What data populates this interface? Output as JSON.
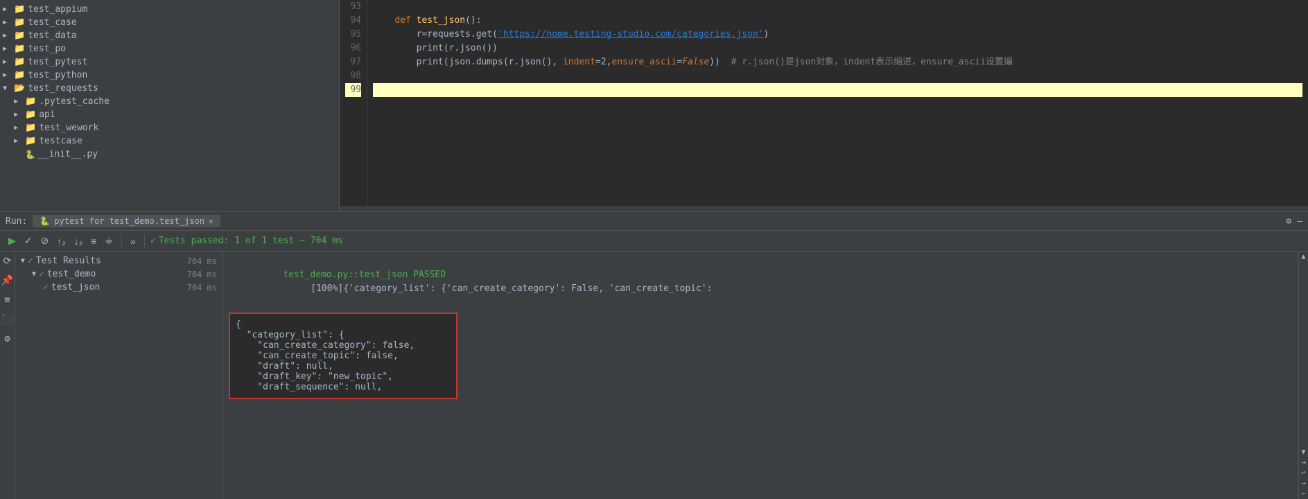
{
  "sidebar": {
    "items": [
      {
        "label": "test_appium",
        "type": "folder",
        "indent": 0,
        "expanded": false
      },
      {
        "label": "test_case",
        "type": "folder",
        "indent": 0,
        "expanded": false
      },
      {
        "label": "test_data",
        "type": "folder",
        "indent": 0,
        "expanded": false
      },
      {
        "label": "test_po",
        "type": "folder",
        "indent": 0,
        "expanded": false
      },
      {
        "label": "test_pytest",
        "type": "folder",
        "indent": 0,
        "expanded": false
      },
      {
        "label": "test_python",
        "type": "folder",
        "indent": 0,
        "expanded": false
      },
      {
        "label": "test_requests",
        "type": "folder",
        "indent": 0,
        "expanded": true
      },
      {
        "label": ".pytest_cache",
        "type": "folder",
        "indent": 1,
        "expanded": false
      },
      {
        "label": "api",
        "type": "folder",
        "indent": 1,
        "expanded": false
      },
      {
        "label": "test_wework",
        "type": "folder",
        "indent": 1,
        "expanded": false
      },
      {
        "label": "testcase",
        "type": "folder",
        "indent": 1,
        "expanded": false
      },
      {
        "label": "__init__.py",
        "type": "file_py",
        "indent": 1,
        "expanded": false
      }
    ]
  },
  "code": {
    "lines": [
      {
        "num": 93,
        "text": ""
      },
      {
        "num": 94,
        "text": "    def test_json():"
      },
      {
        "num": 95,
        "text": "        r=requests.get('https://home.testing-studio.com/categories.json')"
      },
      {
        "num": 96,
        "text": "        print(r.json())"
      },
      {
        "num": 97,
        "text": "        print(json.dumps(r.json(), indent=2,ensure_ascii=False))  # r.json()是json对象，indent表示缩进，ensure_ascii设置编"
      },
      {
        "num": 98,
        "text": ""
      },
      {
        "num": 99,
        "text": "",
        "highlighted": true
      }
    ],
    "url": "https://home.testing-studio.com/categories.json"
  },
  "run": {
    "header_label": "Run:",
    "tab_label": "pytest for test_demo.test_json",
    "gear_icon": "⚙",
    "dash_icon": "—",
    "toolbar": {
      "play_icon": "▶",
      "check_all_icon": "✓",
      "stop_icon": "⊘",
      "sort_asc_icon": "↑↓",
      "sort_desc_icon": "↓↑",
      "filter_icon": "≡",
      "filter2_icon": "≑",
      "more_icon": "»",
      "status_check": "✓",
      "status_text": "Tests passed: 1 of 1 test – 704 ms"
    },
    "results": {
      "root_label": "Test Results",
      "root_time": "704 ms",
      "child1_label": "test_demo",
      "child1_time": "704 ms",
      "child2_label": "test_json",
      "child2_time": "704 ms"
    },
    "output": {
      "passed_line": "test_demo.py::test_json PASSED",
      "percent": "[100%]",
      "json_preview": "[100%]{'category_list': {'can_create_category': False, 'can_create_topic':",
      "json_box": "{\n  \"category_list\": {\n    \"can_create_category\": false,\n    \"can_create_topic\": false,\n    \"draft\": null,\n    \"draft_key\": \"new_topic\",\n    \"draft_sequence\": null,"
    }
  }
}
